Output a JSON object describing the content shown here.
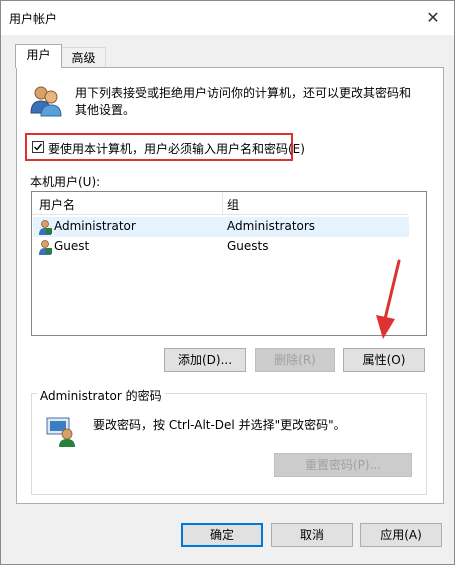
{
  "window": {
    "title": "用户帐户",
    "close_glyph": "✕"
  },
  "tabs": [
    {
      "label": "用户",
      "active": true
    },
    {
      "label": "高级",
      "active": false
    }
  ],
  "users_tab": {
    "description": "用下列表接受或拒绝用户访问你的计算机，还可以更改其密码和其他设置。",
    "require_login_checkbox": {
      "label": "要使用本计算机，用户必须输入用户名和密码(E)",
      "checked": true
    },
    "local_users_label": "本机用户(U):",
    "list": {
      "columns": [
        "用户名",
        "组"
      ],
      "rows": [
        {
          "user": "Administrator",
          "group": "Administrators",
          "selected": true
        },
        {
          "user": "Guest",
          "group": "Guests",
          "selected": false
        }
      ]
    },
    "buttons": {
      "add": "添加(D)...",
      "remove": "删除(R)",
      "properties": "属性(O)"
    },
    "password_group": {
      "title": "Administrator 的密码",
      "text": "要改密码，按 Ctrl-Alt-Del 并选择\"更改密码\"。",
      "reset_button": "重置密码(P)..."
    }
  },
  "footer": {
    "ok": "确定",
    "cancel": "取消",
    "apply": "应用(A)"
  },
  "colors": {
    "highlight": "#e03131",
    "selection": "#e5f3ff",
    "accent": "#0078d7"
  },
  "icons": [
    "users-icon",
    "user-icon",
    "password-user-icon",
    "check-icon",
    "arrow-annotation"
  ]
}
